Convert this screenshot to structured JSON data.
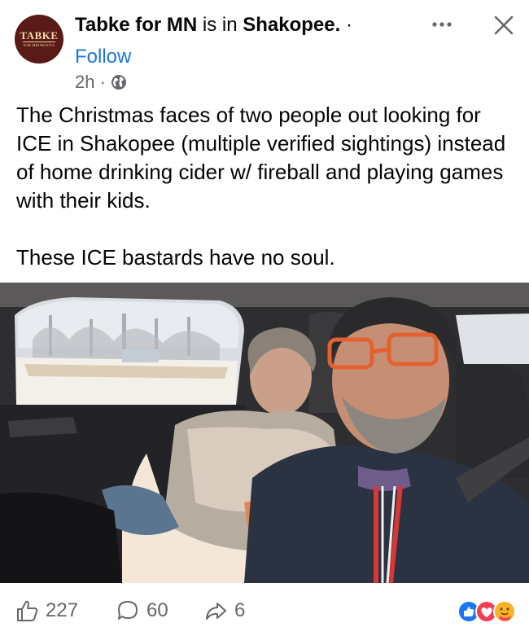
{
  "post": {
    "author": "Tabke for MN",
    "location_prefix": " is in ",
    "location": "Shakopee.",
    "location_suffix": " ·",
    "follow_label": "Follow",
    "time": "2h ·",
    "avatar": {
      "logo_text": "TABKE",
      "logo_subtext": "FOR MINNESOTA",
      "bg_color": "#5a1a17"
    },
    "paragraphs": [
      "The Christmas faces of two people out looking for ICE in Shakopee (multiple verified sightings) instead of home drinking cider w/ fireball and playing games with their kids.",
      "These ICE bastards have no soul."
    ],
    "icons": {
      "more": "more-options-icon",
      "close": "close-icon",
      "audience": "globe-icon"
    }
  },
  "footer": {
    "like_count": "227",
    "comment_count": "60",
    "share_count": "6",
    "icons": [
      "like-icon",
      "comment-icon",
      "share-icon",
      "reactions-icon"
    ]
  },
  "colors": {
    "link_blue": "#1b74e4",
    "secondary_text": "#65676b",
    "like_blue": "#1877f2",
    "love_red": "#f33e58",
    "care_yellow": "#f7b125"
  }
}
